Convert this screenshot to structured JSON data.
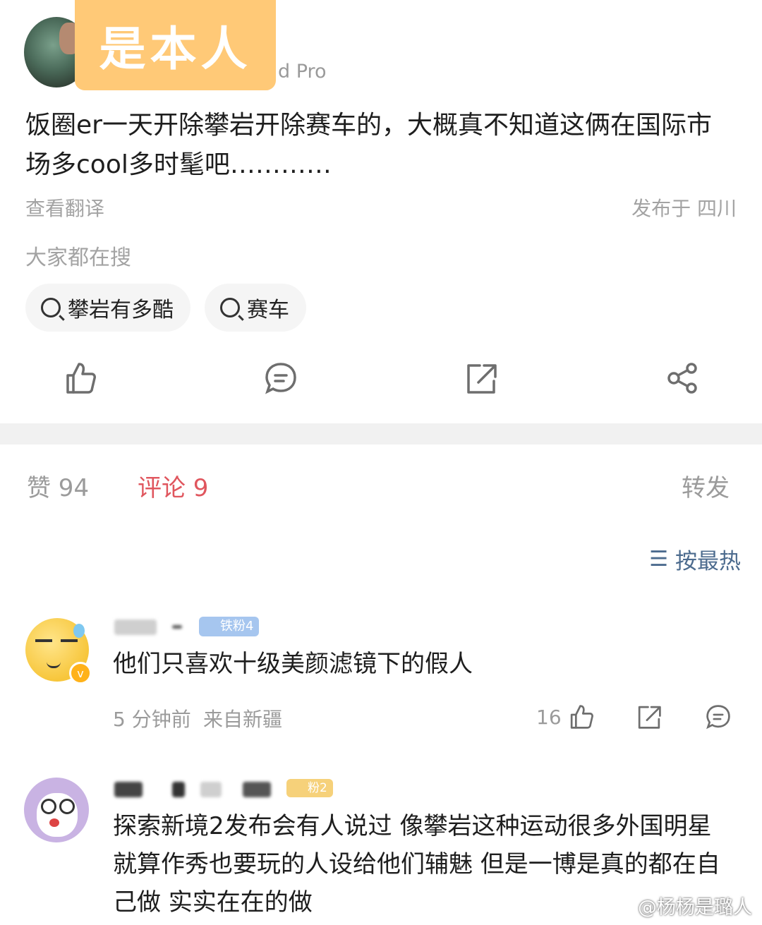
{
  "post": {
    "sticker_text": "是本人",
    "device_suffix": "d Pro",
    "text": "饭圈er一天开除攀岩开除赛车的，大概真不知道这俩在国际市场多cool多时髦吧…………",
    "translate_label": "查看翻译",
    "location": "发布于 四川"
  },
  "search": {
    "title": "大家都在搜",
    "chips": [
      "攀岩有多酷",
      "赛车"
    ]
  },
  "tabs": {
    "likes": "赞 94",
    "comments": "评论 9",
    "reposts": "转发"
  },
  "sort_label": "按最热",
  "comments": [
    {
      "fan_badge": "铁粉4",
      "text": "他们只喜欢十级美颜滤镜下的假人",
      "time": "5 分钟前",
      "source": "来自新疆",
      "likes": "16"
    },
    {
      "fan_badge": "粉2",
      "text": "探索新境2发布会有人说过 像攀岩这种运动很多外国明星就算作秀也要玩的人设给他们辅魅 但是一博是真的都在自己做 实实在在的做"
    }
  ],
  "watermark": "@杨杨是璐人",
  "icons": [
    "thumb-up-icon",
    "comment-icon",
    "repost-icon",
    "share-icon",
    "search-icon",
    "sort-icon"
  ],
  "colors": {
    "accent": "#e0565e",
    "link": "#4c6b8e",
    "sticker": "#ffc977"
  }
}
